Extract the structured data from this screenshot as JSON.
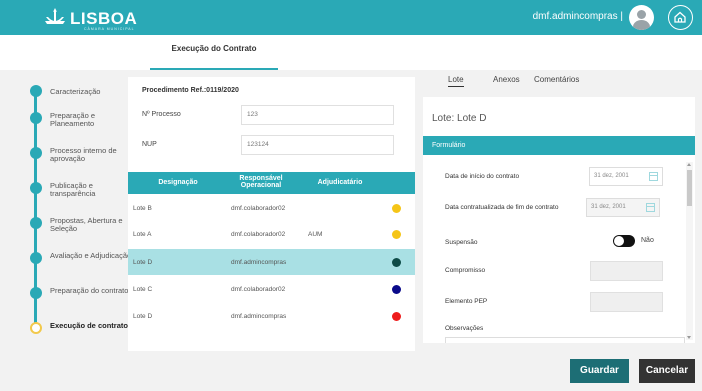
{
  "header": {
    "brand": "LISBOA",
    "brand_sub": "CÂMARA MUNICIPAL",
    "user": "dmf.admincompras |"
  },
  "subheader": {
    "tab": "Execução do Contrato"
  },
  "steps": [
    {
      "label": "Caracterização"
    },
    {
      "label": "Preparação e Planeamento"
    },
    {
      "label": "Processo interno de aprovação"
    },
    {
      "label": "Publicação e transparência"
    },
    {
      "label": "Propostas, Abertura e Seleção"
    },
    {
      "label": "Avaliação e Adjudicação"
    },
    {
      "label": "Preparação do contrato"
    },
    {
      "label": "Execução de contrato"
    }
  ],
  "procedure": {
    "title": "Procedimento Ref.:0119/2020",
    "processo_label": "Nº Processo",
    "processo_value": "123",
    "nup_label": "NUP",
    "nup_value": "123124"
  },
  "table": {
    "headers": [
      "Designação",
      "Responsável Operacional",
      "Adjudicatário"
    ],
    "rows": [
      {
        "designacao": "Lote B",
        "responsavel": "dmf.colaborador02",
        "adjudicatario": "",
        "status_color": "#f5c518"
      },
      {
        "designacao": "Lote A",
        "responsavel": "dmf.colaborador02",
        "adjudicatario": "AUM",
        "status_color": "#f5c518"
      },
      {
        "designacao": "Lote D",
        "responsavel": "dmf.admincompras",
        "adjudicatario": "",
        "status_color": "#0e4b47"
      },
      {
        "designacao": "Lote C",
        "responsavel": "dmf.colaborador02",
        "adjudicatario": "",
        "status_color": "#0a0a8a"
      },
      {
        "designacao": "Lote D",
        "responsavel": "dmf.admincompras",
        "adjudicatario": "",
        "status_color": "#ee1c1c"
      }
    ]
  },
  "right_tabs": [
    "Lote",
    "Anexos",
    "Comentários"
  ],
  "lote": {
    "title": "Lote: Lote D",
    "form_bar": "Formulário",
    "data_inicio_label": "Data de início do contrato",
    "data_inicio_value": "31 dez, 2001",
    "data_fim_label": "Data contratualizada de fim de contrato",
    "data_fim_value": "31 dez, 2001",
    "suspensao_label": "Suspensão",
    "suspensao_toggle": "Não",
    "compromisso_label": "Compromisso",
    "pep_label": "Elemento PEP",
    "observacoes_label": "Observações"
  },
  "actions": {
    "save": "Guardar",
    "cancel": "Cancelar"
  },
  "colors": {
    "accent": "#2aa9b6",
    "dark_accent": "#1d6e75",
    "selected_row": "#a9e0e4"
  }
}
